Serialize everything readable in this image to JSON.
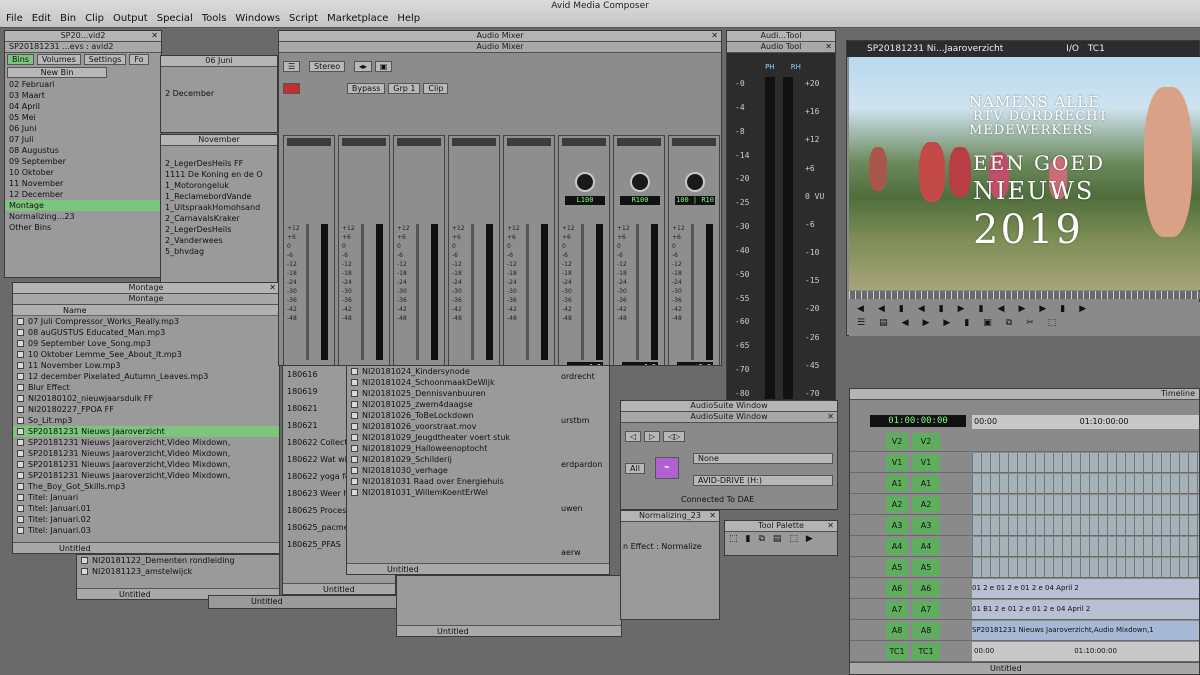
{
  "app": {
    "title": "Avid Media Composer",
    "menu": [
      "File",
      "Edit",
      "Bin",
      "Clip",
      "Output",
      "Special",
      "Tools",
      "Windows",
      "Script",
      "Marketplace",
      "Help"
    ]
  },
  "bins_window": {
    "title": "SP20181231 ...evs : avid2",
    "title_small": "SP20...vid2",
    "tabs": [
      "Bins",
      "Volumes",
      "Settings",
      "Fo"
    ],
    "new_bin": "New Bin",
    "items": [
      "02 Februari",
      "03 Maart",
      "04 April",
      "05 Mei",
      "06 Juni",
      "07 Juli",
      "08 Augustus",
      "09 September",
      "10 Oktober",
      "11 November",
      "12 December",
      "Montage",
      "Normalizing...23",
      "Other Bins"
    ]
  },
  "november_bin": {
    "title": "November",
    "items": [
      "2_LegerDesHeils FF",
      "1111 De Koning en de O",
      "1_Motorongeluk",
      "1_ReclamebordVande",
      "1_UitspraakHomohsand",
      "2_CarnavalsKraker",
      "2_LegerDesHeils",
      "2_Vanderwees",
      "5_bhvdag"
    ],
    "tab_dates": [
      "06 Juni",
      "2 December"
    ]
  },
  "montage_bin": {
    "title": "Montage",
    "column": "Name",
    "items": [
      "07 Juli Compressor_Works_Really.mp3",
      "08 auGUSTUS Educated_Man.mp3",
      "09 September Love_Song.mp3",
      "10 Oktober Lemme_See_About_It.mp3",
      "11 November Low.mp3",
      "12 december Pixelated_Autumn_Leaves.mp3",
      "Blur Effect",
      "NI20180102_nieuwjaarsduik FF",
      "NI20180227_FPOA FF",
      "So_Lit.mp3",
      "SP20181231 Nieuws Jaaroverzicht",
      "SP20181231 Nieuws Jaaroverzicht,Video Mixdown,",
      "SP20181231 Nieuws Jaaroverzicht,Video Mixdown,",
      "SP20181231 Nieuws Jaaroverzicht,Video Mixdown,",
      "SP20181231 Nieuws Jaaroverzicht,Video Mixdown,",
      "The_Boy_Got_Skills.mp3",
      "Titel: Januari",
      "Titel: Januari.01",
      "Titel: Januari.02",
      "Titel: Januari.03"
    ],
    "selected_index": 10,
    "footer": "Untitled"
  },
  "lower_bin": {
    "items": [
      "NI20181122_Dementen rondleiding",
      "NI20181123_amstelwijck"
    ],
    "footer": "Untitled"
  },
  "mid_bin": {
    "items": [
      "180616",
      "180619",
      "180621",
      "180621",
      "180622 Collecti",
      "180622 Wat wil",
      "180622 yoga fo",
      "180623 Weer he",
      "180625 Proces",
      "180625_pacmenk",
      "180625_PFAS"
    ],
    "footer": "Untitled"
  },
  "oct_bin": {
    "items": [
      "NI20181024_Kindersynode",
      "NI20181024_SchoonmaakDeWijk",
      "NI20181025_Dennisvanbuuren",
      "NI20181025_zwem4daagse",
      "NI20181026_ToBeLockdown",
      "NI20181026_voorstraat.mov",
      "NI20181029_Jeugdtheater voert stuk",
      "NI20181029_Halloweenoptocht",
      "NI20181029_Schilderij",
      "NI20181030_verhage",
      "NI20181031 Raad over Energiehuis",
      "NI20181031_WillemKoentErWel"
    ],
    "right_fragments": [
      "ordrecht",
      "urstbm",
      "erdpardon",
      "uwen",
      "aerw"
    ],
    "footer": "Untitled"
  },
  "audio_mixer": {
    "title": "Audio Mixer",
    "tab": "Audio Mixer",
    "stereo_label": "Stereo",
    "bypass": "Bypass",
    "grp": "Grp 1",
    "clip": "Clip",
    "channels": [
      {
        "label": "A1",
        "volume": ""
      },
      {
        "label": "A2",
        "volume": ""
      },
      {
        "label": "A3",
        "volume": ""
      },
      {
        "label": "A4",
        "volume": ""
      },
      {
        "label": "A5",
        "volume": ""
      },
      {
        "label": "A6",
        "volume": "-4.0",
        "pan": "L100"
      },
      {
        "label": "A7",
        "volume": "-4.0",
        "pan": "R100"
      },
      {
        "label": "A8",
        "volume": "+0.0",
        "pan": "100 | R10"
      }
    ],
    "scale": [
      "+12",
      "+6",
      "0",
      "-6",
      "-12",
      "-18",
      "-24",
      "-30",
      "-36",
      "-42",
      "-48"
    ]
  },
  "audio_tool": {
    "title": "Audi...Tool",
    "tab": "Audio Tool",
    "left_scale": [
      "-0",
      "-4",
      "-8",
      "-14",
      "-20",
      "-25",
      "-30",
      "-40",
      "-50",
      "-55",
      "-60",
      "-65",
      "-70",
      "-80"
    ],
    "right_scale": [
      "+20",
      "+16",
      "+12",
      "+6",
      "0 VU",
      "-6",
      "-10",
      "-15",
      "-20",
      "-26",
      "-45",
      "-70"
    ],
    "top_labels": [
      "PH",
      "RH"
    ]
  },
  "record_monitor": {
    "title": "SP20181231 Ni...Jaaroverzicht",
    "timecode_label": "I/O",
    "timecode_value": "TC1",
    "overlay": {
      "line1": "NAMENS ALLE",
      "line2": "RTV DORDRECHT",
      "line3": "MEDEWERKERS",
      "line4": "EEN GOED",
      "line5": "NIEUWS",
      "line6": "2019"
    }
  },
  "audiosuite": {
    "title": "AudioSuite Window",
    "tab": "AudioSuite Window",
    "track": "None",
    "drive": "AVID-DRIVE (H:)",
    "status": "Connected To DAE",
    "all": "All"
  },
  "effect_window": {
    "title": "Normalizing_23",
    "effect_label": "n Effect : Normalize"
  },
  "tool_palette": {
    "title": "Tool Palette"
  },
  "timeline": {
    "title": "Timeline",
    "timecode": "01:00:00:00",
    "ruler": [
      "00:00",
      "01:10:00:00"
    ],
    "tracks": [
      {
        "src": "V2",
        "rec": "V2"
      },
      {
        "src": "V1",
        "rec": "V1"
      },
      {
        "src": "A1",
        "rec": "A1"
      },
      {
        "src": "A2",
        "rec": "A2"
      },
      {
        "src": "A3",
        "rec": "A3"
      },
      {
        "src": "A4",
        "rec": "A4"
      },
      {
        "src": "A5",
        "rec": "A5"
      },
      {
        "src": "A6",
        "rec": "A6"
      },
      {
        "src": "A7",
        "rec": "A7"
      },
      {
        "src": "A8",
        "rec": "A8"
      },
      {
        "src": "TC1",
        "rec": "TC1"
      }
    ],
    "clip_label": "SP20181231 Nieuws Jaaroverzicht,Audio Mixdown,1",
    "bottom_ruler": [
      "00:00",
      "01:10:00:00"
    ],
    "footer": "Untitled",
    "a6_clip": "01 2 e 01 2 e 01 2 e 04 April 2",
    "a7_clip": "01 B1 2 e 01 2 e 01 2 e 04 April 2"
  },
  "colors": {
    "panel": "#9a9a9a",
    "track_green": "#5fae5f",
    "selection_green": "#7cc57c",
    "desktop": "#6a6a6a"
  }
}
